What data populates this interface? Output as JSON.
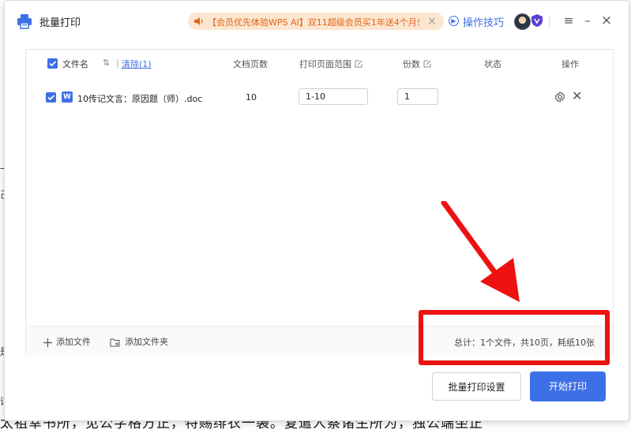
{
  "background_document": {
    "bottom_text": "太祖幸书所，见公字格方正，特赐绯衣一袭。复遣人察诸生所为，独公端坐正",
    "margin_marks": [
      "一",
      "己",
      "是",
      "话"
    ]
  },
  "titlebar": {
    "title": "批量打印",
    "promo_text": "【会员优先体验WPS AI】双11超级会员买1年送4个月!",
    "promo_close": "×",
    "tips_label": "操作技巧",
    "menu_label": "≡",
    "minimize_label": "–",
    "close_label": "×"
  },
  "table": {
    "headers": {
      "filename": "文件名",
      "sort": "⇅",
      "clear": "清除(1)",
      "pages": "文档页数",
      "range": "打印页面范围",
      "copies": "份数",
      "status": "状态",
      "actions": "操作"
    },
    "rows": [
      {
        "file_icon": "W",
        "filename": "10传记文言：原因题（师）.doc",
        "pages": "10",
        "range": "1-10",
        "copies": "1",
        "status": ""
      }
    ]
  },
  "footer": {
    "add_file": "添加文件",
    "add_folder": "添加文件夹",
    "summary": "总计：1个文件，共10页，耗纸10张"
  },
  "actions": {
    "settings": "批量打印设置",
    "start": "开始打印"
  },
  "colors": {
    "accent": "#3d6fe7",
    "promo_bg": "#fde6cf",
    "promo_text": "#e0641b",
    "annotation": "#ee1111"
  }
}
